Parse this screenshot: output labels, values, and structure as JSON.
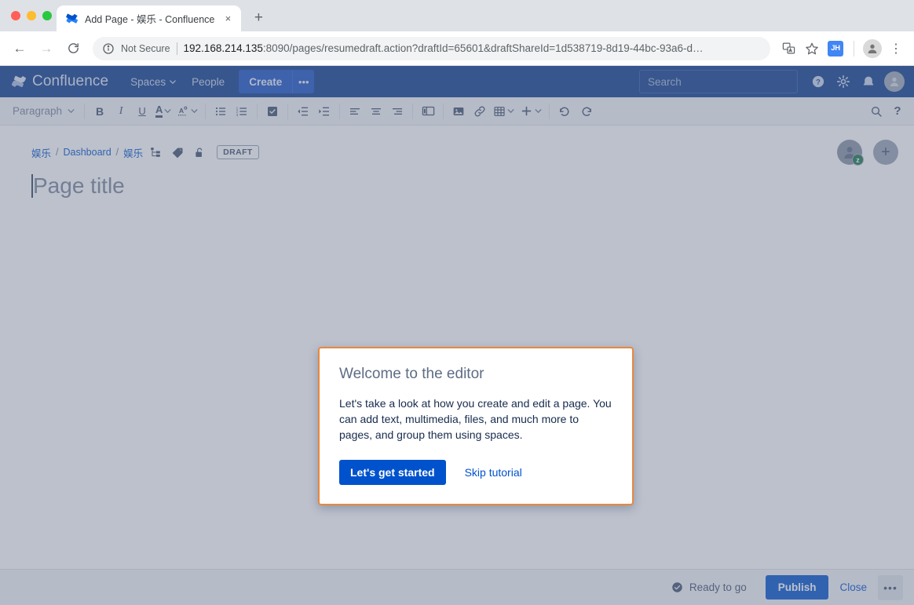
{
  "browser": {
    "tab": {
      "title": "Add Page - 娱乐 - Confluence",
      "favicon": "confluence-favicon",
      "close_label": "×"
    },
    "new_tab_label": "+",
    "nav": {
      "back": "←",
      "forward": "→",
      "reload": "⟳"
    },
    "omnibox": {
      "security_label": "Not Secure",
      "url_host": "192.168.214.135",
      "url_rest": ":8090/pages/resumedraft.action?draftId=65601&draftShareId=1d538719-8d19-44bc-93a6-d…"
    },
    "toolbar_icons": {
      "translate": "translate-icon",
      "bookmark": "☆",
      "extension_badge": "JH",
      "profile": "profile-icon",
      "menu": "⋮"
    }
  },
  "confluence": {
    "logo_text": "Confluence",
    "nav": [
      {
        "label": "Spaces",
        "has_caret": true
      },
      {
        "label": "People",
        "has_caret": false
      }
    ],
    "create_label": "Create",
    "create_more_label": "•••",
    "search_placeholder": "Search",
    "header_icons": [
      "help-icon",
      "settings-icon",
      "notifications-icon",
      "avatar"
    ]
  },
  "editor_toolbar": {
    "style_label": "Paragraph",
    "tools": [
      "bold",
      "italic",
      "underline",
      "text-color",
      "text-highlight",
      "bullet-list",
      "numbered-list",
      "task-list",
      "outdent",
      "indent",
      "align-left",
      "align-center",
      "align-right",
      "page-layout",
      "insert-image",
      "insert-link",
      "insert-table",
      "insert-more",
      "undo",
      "redo"
    ],
    "right_tools": [
      "find-replace",
      "help"
    ]
  },
  "page": {
    "breadcrumbs": [
      {
        "label": "娱乐",
        "link": true
      },
      {
        "label": "/",
        "link": false
      },
      {
        "label": "Dashboard",
        "link": true
      },
      {
        "label": "/",
        "link": false
      },
      {
        "label": "娱乐",
        "link": true
      }
    ],
    "crumb_icons": [
      "page-tree-icon",
      "label-tag-icon",
      "unlock-icon"
    ],
    "status_badge": "DRAFT",
    "collaborator_badge": "z",
    "add_collaborator_label": "+",
    "title_placeholder": "Page title"
  },
  "modal": {
    "title": "Welcome to the editor",
    "body": "Let's take a look at how you create and edit a page. You can add text, multimedia, files, and much more to pages, and group them using spaces.",
    "primary_label": "Let's get started",
    "secondary_label": "Skip tutorial",
    "border_color": "#E8883C"
  },
  "bottom_bar": {
    "status_text": "Ready to go",
    "publish_label": "Publish",
    "close_label": "Close",
    "more_label": "•••"
  },
  "colors": {
    "header_blue": "#0E3C8E",
    "accent_blue": "#0052CC",
    "create_blue": "#1A52C4",
    "modal_border": "#E8883C",
    "overlay": "#9AA1B0"
  }
}
